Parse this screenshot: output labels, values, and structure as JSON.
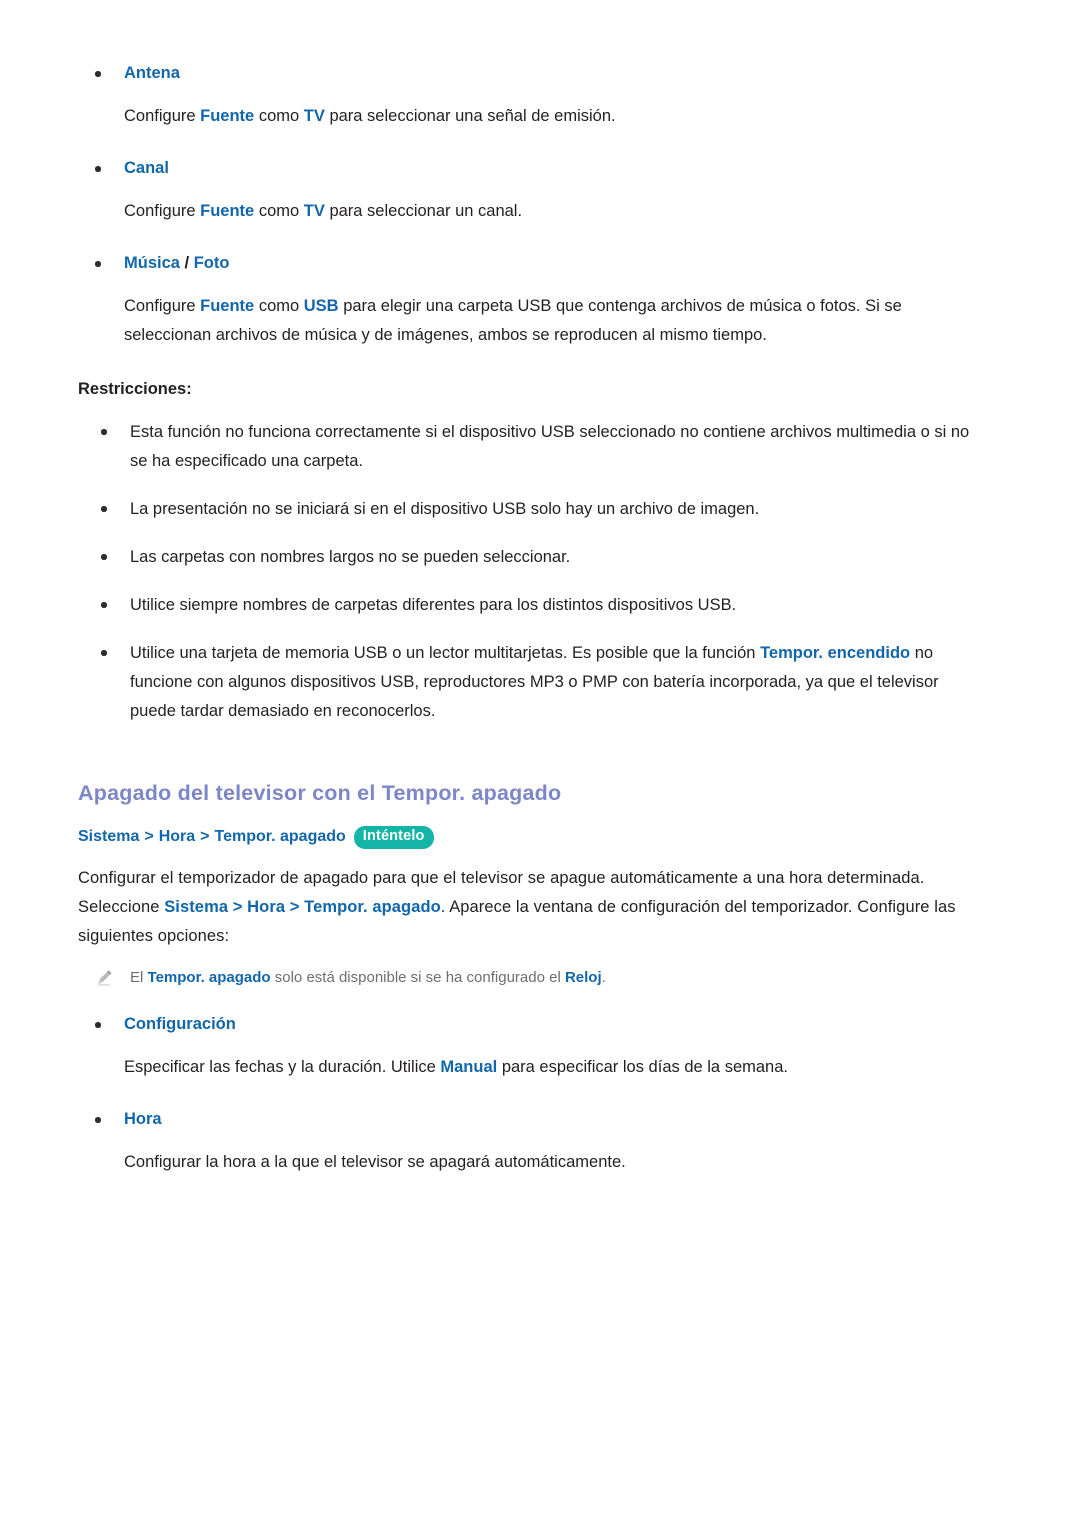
{
  "document": {
    "options_list": [
      {
        "term": "Antena",
        "term_parts": [
          {
            "text": "Antena",
            "style": "blue"
          }
        ],
        "description_parts": [
          {
            "text": "Configure ",
            "style": "plain"
          },
          {
            "text": "Fuente",
            "style": "blue"
          },
          {
            "text": " como ",
            "style": "plain"
          },
          {
            "text": "TV",
            "style": "blue"
          },
          {
            "text": " para seleccionar una señal de emisión.",
            "style": "plain"
          }
        ]
      },
      {
        "term": "Canal",
        "term_parts": [
          {
            "text": "Canal",
            "style": "blue"
          }
        ],
        "description_parts": [
          {
            "text": "Configure ",
            "style": "plain"
          },
          {
            "text": "Fuente",
            "style": "blue"
          },
          {
            "text": " como ",
            "style": "plain"
          },
          {
            "text": "TV",
            "style": "blue"
          },
          {
            "text": " para seleccionar un canal.",
            "style": "plain"
          }
        ]
      },
      {
        "term": "Música / Foto",
        "term_parts": [
          {
            "text": "Música",
            "style": "blue"
          },
          {
            "text": " / ",
            "style": "black"
          },
          {
            "text": "Foto",
            "style": "blue"
          }
        ],
        "description_parts": [
          {
            "text": "Configure ",
            "style": "plain"
          },
          {
            "text": "Fuente",
            "style": "blue"
          },
          {
            "text": " como ",
            "style": "plain"
          },
          {
            "text": "USB",
            "style": "blue"
          },
          {
            "text": " para elegir una carpeta USB que contenga archivos de música o fotos. Si se seleccionan archivos de música y de imágenes, ambos se reproducen al mismo tiempo.",
            "style": "plain"
          }
        ]
      }
    ],
    "restrictions_label": "Restricciones:",
    "restrictions": [
      [
        {
          "text": "Esta función no funciona correctamente si el dispositivo USB seleccionado no contiene archivos multimedia o si no se ha especificado una carpeta.",
          "style": "plain"
        }
      ],
      [
        {
          "text": "La presentación no se iniciará si en el dispositivo USB solo hay un archivo de imagen.",
          "style": "plain"
        }
      ],
      [
        {
          "text": "Las carpetas con nombres largos no se pueden seleccionar.",
          "style": "plain"
        }
      ],
      [
        {
          "text": "Utilice siempre nombres de carpetas diferentes para los distintos dispositivos USB.",
          "style": "plain"
        }
      ],
      [
        {
          "text": "Utilice una tarjeta de memoria USB o un lector multitarjetas. Es posible que la función ",
          "style": "plain"
        },
        {
          "text": "Tempor. encendido",
          "style": "blue"
        },
        {
          "text": " no funcione con algunos dispositivos USB, reproductores MP3 o PMP con batería incorporada, ya que el televisor puede tardar demasiado en reconocerlos.",
          "style": "plain"
        }
      ]
    ],
    "section": {
      "heading": "Apagado del televisor con el Tempor. apagado",
      "breadcrumb": {
        "items": [
          "Sistema",
          "Hora",
          "Tempor. apagado"
        ],
        "separator": ">",
        "badge": "Inténtelo"
      },
      "intro_parts": [
        {
          "text": "Configurar el temporizador de apagado para que el televisor se apague automáticamente a una hora determinada. Seleccione ",
          "style": "plain"
        },
        {
          "text": "Sistema",
          "style": "blue"
        },
        {
          "text": " > ",
          "style": "blue"
        },
        {
          "text": "Hora",
          "style": "blue"
        },
        {
          "text": " > ",
          "style": "blue"
        },
        {
          "text": "Tempor. apagado",
          "style": "blue"
        },
        {
          "text": ". Aparece la ventana de configuración del temporizador. Configure las siguientes opciones:",
          "style": "plain"
        }
      ],
      "note_parts": [
        {
          "text": "El ",
          "style": "note"
        },
        {
          "text": "Tempor. apagado",
          "style": "blue"
        },
        {
          "text": " solo está disponible si se ha configurado el ",
          "style": "note"
        },
        {
          "text": "Reloj",
          "style": "blue"
        },
        {
          "text": ".",
          "style": "note"
        }
      ],
      "note_icon": "pencil-icon",
      "options_list": [
        {
          "term": "Configuración",
          "term_parts": [
            {
              "text": "Configuración",
              "style": "blue"
            }
          ],
          "description_parts": [
            {
              "text": "Especificar las fechas y la duración. Utilice ",
              "style": "plain"
            },
            {
              "text": "Manual",
              "style": "blue"
            },
            {
              "text": " para especificar los días de la semana.",
              "style": "plain"
            }
          ]
        },
        {
          "term": "Hora",
          "term_parts": [
            {
              "text": "Hora",
              "style": "blue"
            }
          ],
          "description_parts": [
            {
              "text": "Configurar la hora a la que el televisor se apagará automáticamente.",
              "style": "plain"
            }
          ]
        }
      ]
    },
    "colors": {
      "link_blue": "#1266ab",
      "heading_purple": "#7d86c8",
      "badge_teal": "#14b5a6",
      "body_black": "#231f20",
      "note_gray": "#6d6e71",
      "background": "#ffffff"
    }
  }
}
